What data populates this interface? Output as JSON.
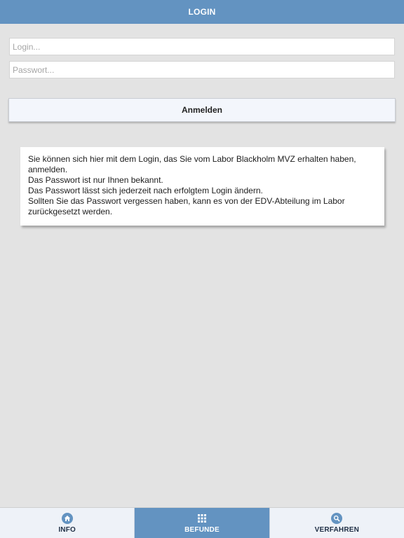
{
  "header": {
    "title": "LOGIN"
  },
  "form": {
    "login_placeholder": "Login...",
    "password_placeholder": "Passwort...",
    "submit_label": "Anmelden"
  },
  "info": {
    "lines": [
      "Sie können sich hier mit dem Login, das Sie vom Labor Blackholm MVZ erhalten haben, anmelden.",
      "Das Passwort ist nur Ihnen bekannt.",
      "Das Passwort lässt sich jederzeit nach erfolgtem Login ändern.",
      "Sollten Sie das Passwort vergessen haben, kann es von der EDV-Abteilung im Labor zurückgesetzt werden."
    ]
  },
  "tabs": [
    {
      "label": "INFO",
      "icon": "home-icon",
      "active": false
    },
    {
      "label": "BEFUNDE",
      "icon": "grid-icon",
      "active": true
    },
    {
      "label": "VERFAHREN",
      "icon": "search-icon",
      "active": false
    }
  ],
  "colors": {
    "accent": "#6393c1",
    "background": "#e3e3e3",
    "tab_background": "#eef2f8"
  }
}
